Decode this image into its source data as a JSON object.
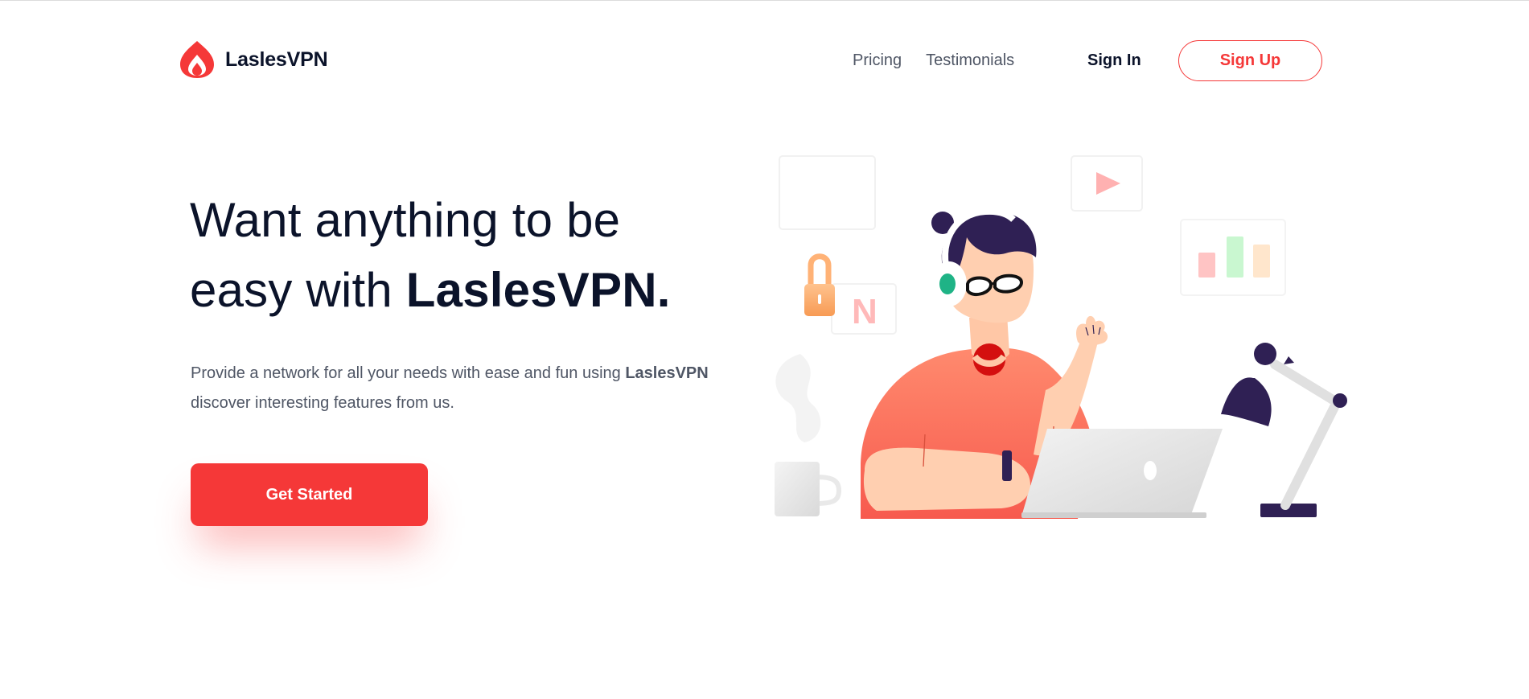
{
  "brand": {
    "name": "LaslesVPN",
    "accent_color": "#f53838",
    "text_color": "#0b132a",
    "muted_color": "#4f5665"
  },
  "nav": {
    "links": [
      "Pricing",
      "Testimonials"
    ],
    "sign_in": "Sign In",
    "sign_up": "Sign Up"
  },
  "hero": {
    "title_line1": "Want anything to be",
    "title_line2_prefix": "easy with ",
    "title_brand": "LaslesVPN.",
    "description_prefix": "Provide a network for all your needs with ease and fun using ",
    "description_brand": "LaslesVPN",
    "description_suffix": "discover interesting features from us.",
    "cta_label": "Get Started"
  },
  "illustration": {
    "floating_letter": "N",
    "icons": [
      "padlock-icon",
      "play-icon",
      "bar-chart-icon",
      "desk-lamp-icon",
      "mug-icon",
      "laptop-icon"
    ]
  }
}
